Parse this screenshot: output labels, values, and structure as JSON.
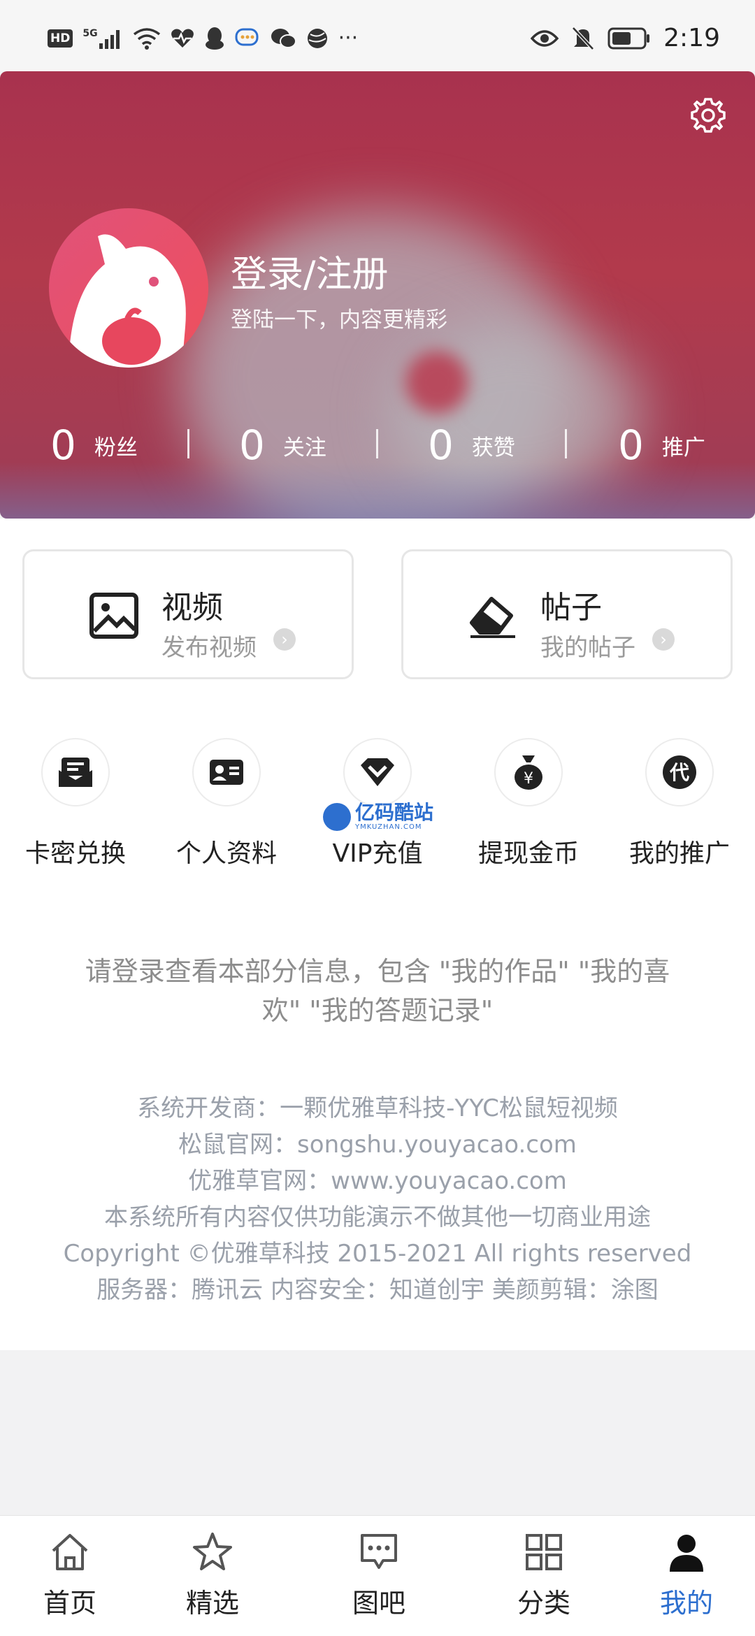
{
  "status_bar": {
    "left_icons": [
      "hd-badge",
      "5g-signal-icon",
      "wifi-icon",
      "heart-rate-icon",
      "qq-icon",
      "chat-icon",
      "wechat-icon",
      "globe-icon",
      "more-dots-icon"
    ],
    "hd_label": "HD",
    "network_label": "5G",
    "time": "2:19"
  },
  "profile": {
    "title": "登录/注册",
    "subtitle": "登陆一下，内容更精彩",
    "stats": [
      {
        "value": "0",
        "label": "粉丝"
      },
      {
        "value": "0",
        "label": "关注"
      },
      {
        "value": "0",
        "label": "获赞"
      },
      {
        "value": "0",
        "label": "推广"
      }
    ]
  },
  "cards": [
    {
      "title": "视频",
      "subtitle": "发布视频",
      "icon": "image-icon"
    },
    {
      "title": "帖子",
      "subtitle": "我的帖子",
      "icon": "eraser-icon"
    }
  ],
  "menu": [
    {
      "label": "卡密兑换",
      "icon": "envelope-icon"
    },
    {
      "label": "个人资料",
      "icon": "id-card-icon"
    },
    {
      "label": "VIP充值",
      "icon": "diamond-icon"
    },
    {
      "label": "提现金币",
      "icon": "money-bag-icon"
    },
    {
      "label": "我的推广",
      "icon": "dai-icon"
    }
  ],
  "watermark": {
    "name": "亿码酷站",
    "domain": "YMKUZHAN.COM"
  },
  "notice": "请登录查看本部分信息，包含 \"我的作品\" \"我的喜欢\" \"我的答题记录\"",
  "footer_lines": [
    "系统开发商：一颗优雅草科技-YYC松鼠短视频",
    "松鼠官网：songshu.youyacao.com",
    "优雅草官网：www.youyacao.com",
    "本系统所有内容仅供功能演示不做其他一切商业用途",
    "Copyright ©优雅草科技 2015-2021 All rights reserved",
    "服务器：腾讯云 内容安全：知道创宇 美颜剪辑：涂图"
  ],
  "tabs": [
    {
      "label": "首页",
      "icon": "home-icon"
    },
    {
      "label": "精选",
      "icon": "star-icon"
    },
    {
      "label": "图吧",
      "icon": "message-icon"
    },
    {
      "label": "分类",
      "icon": "grid-icon"
    },
    {
      "label": "我的",
      "icon": "user-icon",
      "active": true
    }
  ],
  "colors": {
    "accent": "#2d6fcf",
    "header": "#a8324e"
  }
}
